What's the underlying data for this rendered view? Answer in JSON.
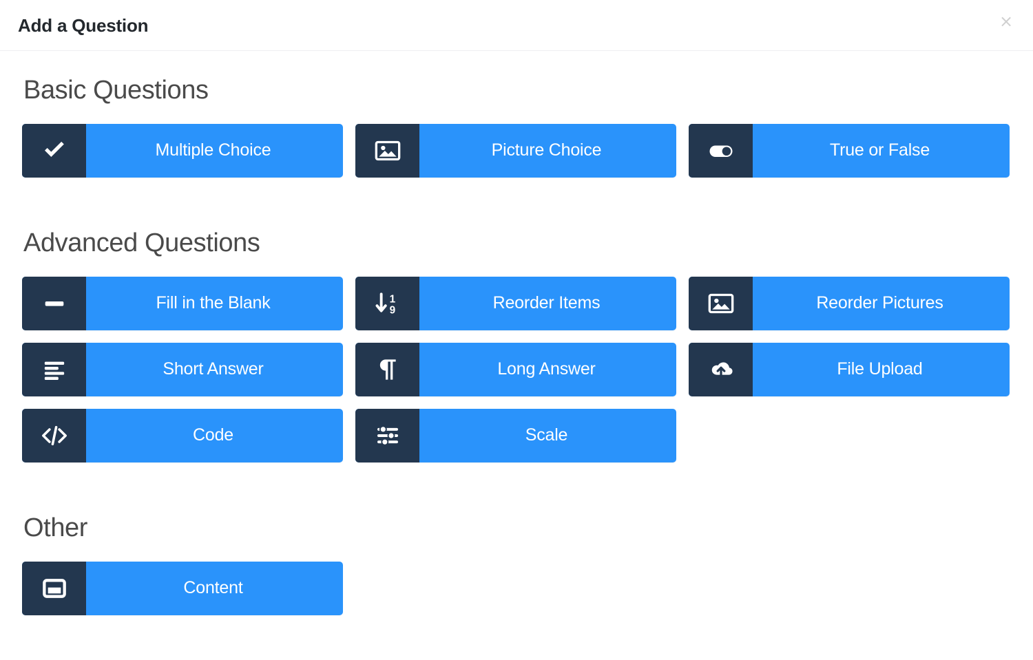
{
  "header": {
    "title": "Add a Question",
    "close_label": "×",
    "close_icon": "close-icon"
  },
  "theme": {
    "accent_blue": "#2a93fb",
    "icon_navy": "#23374f",
    "title_color": "#23282d",
    "section_title_color": "#4a4a4a",
    "page_background": "#ffffff",
    "divider": "#efeff1"
  },
  "sections": [
    {
      "id": "basic",
      "title": "Basic Questions",
      "tiles": [
        {
          "label": "Multiple Choice",
          "icon": "check-icon"
        },
        {
          "label": "Picture Choice",
          "icon": "image-icon"
        },
        {
          "label": "True or False",
          "icon": "toggle-switch-icon"
        }
      ]
    },
    {
      "id": "advanced",
      "title": "Advanced Questions",
      "tiles": [
        {
          "label": "Fill in the Blank",
          "icon": "minus-bar-icon"
        },
        {
          "label": "Reorder Items",
          "icon": "sort-numeric-down-icon"
        },
        {
          "label": "Reorder Pictures",
          "icon": "image-icon"
        },
        {
          "label": "Short Answer",
          "icon": "align-left-icon"
        },
        {
          "label": "Long Answer",
          "icon": "pilcrow-icon"
        },
        {
          "label": "File Upload",
          "icon": "cloud-upload-icon"
        },
        {
          "label": "Code",
          "icon": "code-icon"
        },
        {
          "label": "Scale",
          "icon": "sliders-icon"
        }
      ]
    },
    {
      "id": "other",
      "title": "Other",
      "tiles": [
        {
          "label": "Content",
          "icon": "window-icon"
        }
      ]
    }
  ]
}
